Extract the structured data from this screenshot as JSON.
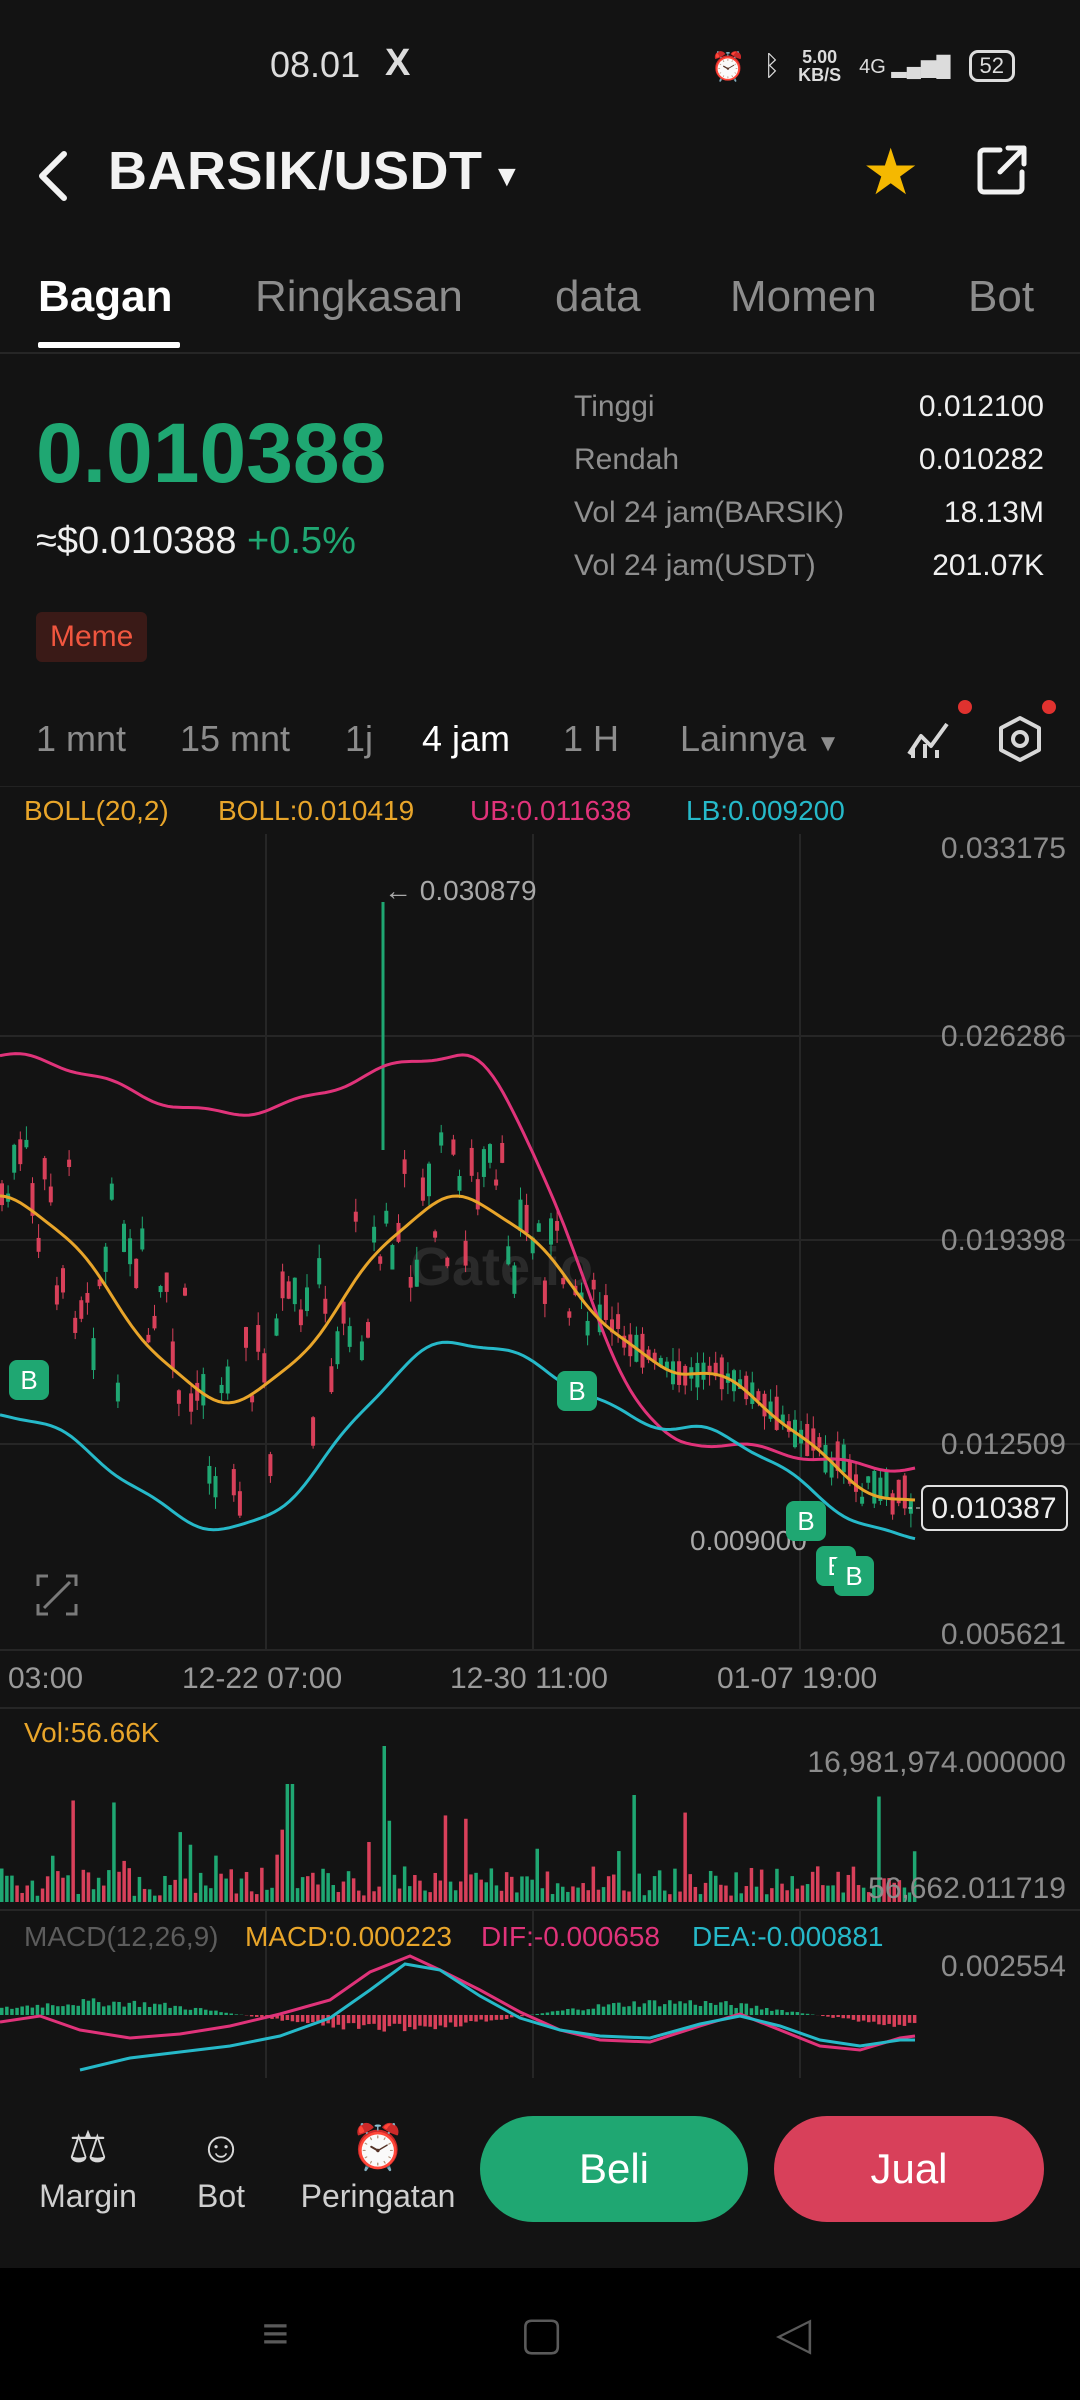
{
  "status": {
    "time": "08.01",
    "x_icon": "X",
    "net_speed": "5.00\nKB/S",
    "net_speed_top": "5.00",
    "net_speed_bottom": "KB/S",
    "signal": "4G",
    "battery": "52"
  },
  "header": {
    "pair": "BARSIK/USDT",
    "star_color": "#f5b800"
  },
  "tabs": [
    {
      "label": "Bagan"
    },
    {
      "label": "Ringkasan"
    },
    {
      "label": "data"
    },
    {
      "label": "Momen"
    },
    {
      "label": "Bot"
    }
  ],
  "price": {
    "last": "0.010388",
    "usd": "≈$0.010388",
    "change": "+0.5%",
    "tag": "Meme"
  },
  "stats": [
    {
      "label": "Tinggi",
      "value": "0.012100"
    },
    {
      "label": "Rendah",
      "value": "0.010282"
    },
    {
      "label": "Vol 24 jam(BARSIK)",
      "value": "18.13M"
    },
    {
      "label": "Vol 24 jam(USDT)",
      "value": "201.07K"
    }
  ],
  "intervals": [
    {
      "label": "1 mnt"
    },
    {
      "label": "15 mnt"
    },
    {
      "label": "1j"
    },
    {
      "label": "4 jam"
    },
    {
      "label": "1 H"
    },
    {
      "label": "Lainnya"
    }
  ],
  "boll": {
    "name": "BOLL(20,2)",
    "mid": "BOLL:0.010419",
    "ub": "UB:0.011638",
    "lb": "LB:0.009200"
  },
  "chart": {
    "y_labels": [
      "0.033175",
      "0.026286",
      "0.019398",
      "0.012509",
      "0.005621"
    ],
    "x_labels": [
      "03:00",
      "12-22 07:00",
      "12-30 11:00",
      "01-07 19:00"
    ],
    "high_marker": "← 0.030879",
    "low_marker": "0.009000",
    "current_price": "0.010387",
    "trade_marker": "B",
    "watermark": "Gate.io"
  },
  "volume": {
    "label": "Vol:56.66K",
    "max": "16,981,974.000000",
    "cur": "56,662.011719"
  },
  "macd": {
    "name": "MACD(12,26,9)",
    "macd": "MACD:0.000223",
    "dif": "DIF:-0.000658",
    "dea": "DEA:-0.000881",
    "max": "0.002554"
  },
  "actions": [
    {
      "label": "Margin"
    },
    {
      "label": "Bot"
    },
    {
      "label": "Peringatan"
    }
  ],
  "buttons": {
    "buy": "Beli",
    "sell": "Jual"
  },
  "colors": {
    "up": "#1fa772",
    "down": "#d8405a",
    "upper_band": "#e0337a",
    "middle_band": "#e8a52a",
    "lower_band": "#26b9c9"
  },
  "chart_data": {
    "type": "line",
    "title": "",
    "xlabel": "",
    "ylabel": "",
    "ylim": [
      0.005621,
      0.033175
    ],
    "x": [
      "03:00",
      "12-22 07:00",
      "12-30 11:00",
      "01-07 19:00"
    ],
    "series": [
      {
        "name": "UB",
        "values": [
          0.026,
          0.024,
          0.026,
          0.0125,
          0.0116
        ]
      },
      {
        "name": "BOLL",
        "values": [
          0.021,
          0.014,
          0.021,
          0.015,
          0.0104
        ]
      },
      {
        "name": "LB",
        "values": [
          0.0135,
          0.0095,
          0.016,
          0.013,
          0.0092
        ]
      }
    ]
  }
}
